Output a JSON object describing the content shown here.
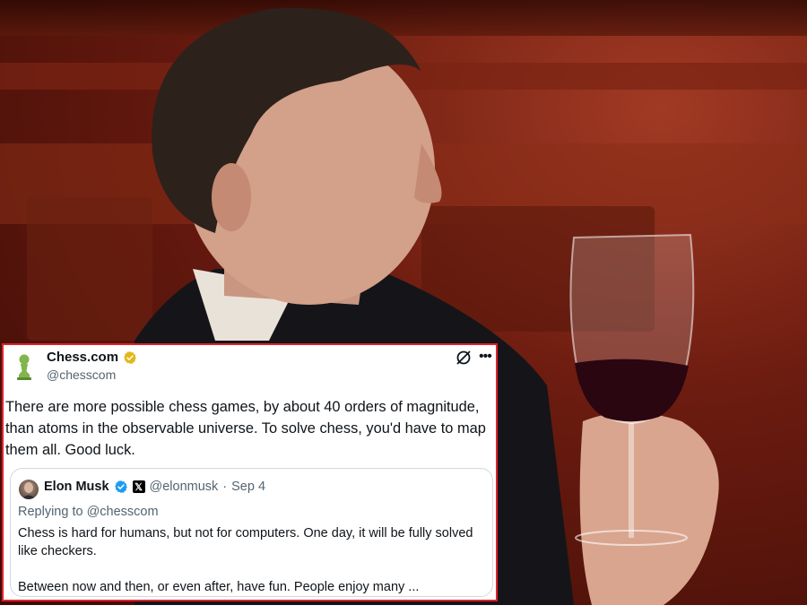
{
  "tweet": {
    "author_name": "Chess.com",
    "author_handle": "@chesscom",
    "text": "There are more possible chess games, by about 40 orders of magnitude, than atoms in the observable universe. To solve chess, you'd have to map them all. Good luck.",
    "icons": [
      "pawn-avatar-icon",
      "verified-gold-icon",
      "grok-icon",
      "more-icon"
    ],
    "colors": {
      "border": "#e0212b",
      "verified": "#e2b719",
      "avatar_pawn": "#81b64c"
    }
  },
  "quoted_tweet": {
    "author_name": "Elon Musk",
    "author_handle": "@elonmusk",
    "separator": "·",
    "date": "Sep 4",
    "replying_prefix": "Replying to",
    "replying_handle": "@chesscom",
    "paragraph_1": "Chess is hard for humans, but not for computers. One day, it will be fully solved like checkers.",
    "paragraph_2": "Between now and then, or even after, have fun. People enjoy many ...",
    "icons": [
      "avatar",
      "verified-blue-icon",
      "x-affiliation-icon"
    ],
    "colors": {
      "verified": "#1d9bf0"
    }
  }
}
